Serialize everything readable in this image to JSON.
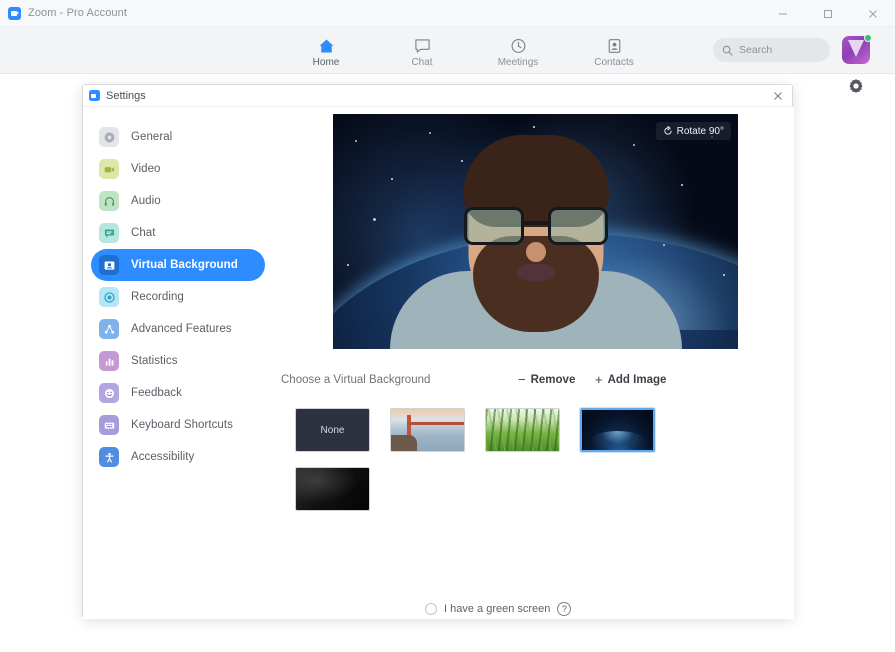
{
  "window": {
    "title": "Zoom - Pro Account",
    "app_icon": "zoom-camera-icon",
    "minimize_label": "–",
    "maximize_label": "□",
    "close_label": "✕"
  },
  "navbar": {
    "tabs": [
      {
        "label": "Home",
        "icon": "home-icon",
        "active": true
      },
      {
        "label": "Chat",
        "icon": "chat-bubble-icon",
        "active": false
      },
      {
        "label": "Meetings",
        "icon": "clock-icon",
        "active": false
      },
      {
        "label": "Contacts",
        "icon": "contacts-icon",
        "active": false
      }
    ],
    "search": {
      "placeholder": "Search",
      "icon": "search-icon"
    },
    "avatar": {
      "name": "user-avatar",
      "status": "available",
      "status_color": "#32c36c"
    },
    "gear": {
      "icon": "gear-icon"
    }
  },
  "dialog": {
    "title": "Settings",
    "icon": "zoom-camera-icon",
    "close_label": "✕"
  },
  "sidebar": {
    "items": [
      {
        "label": "General",
        "icon": "gear-icon",
        "color": "#c8cbd0",
        "active": false
      },
      {
        "label": "Video",
        "icon": "video-camera-icon",
        "color": "#c3d35e",
        "active": false
      },
      {
        "label": "Audio",
        "icon": "headphones-icon",
        "color": "#6dc07a",
        "active": false
      },
      {
        "label": "Chat",
        "icon": "chat-bubble-icon",
        "color": "#57c8bc",
        "active": false
      },
      {
        "label": "Virtual Background",
        "icon": "person-card-icon",
        "color": "#2d8cff",
        "active": true
      },
      {
        "label": "Recording",
        "icon": "record-dot-icon",
        "color": "#4fc3e8",
        "active": false
      },
      {
        "label": "Advanced Features",
        "icon": "network-nodes-icon",
        "color": "#6aa6e8",
        "active": false
      },
      {
        "label": "Statistics",
        "icon": "bar-chart-icon",
        "color": "#b57ac8",
        "active": false
      },
      {
        "label": "Feedback",
        "icon": "smiley-icon",
        "color": "#9b86d8",
        "active": false
      },
      {
        "label": "Keyboard Shortcuts",
        "icon": "keyboard-icon",
        "color": "#8a7fd0",
        "active": false
      },
      {
        "label": "Accessibility",
        "icon": "accessibility-person-icon",
        "color": "#4f8ee0",
        "active": false
      }
    ]
  },
  "content": {
    "video_preview": {
      "rotate_button": {
        "label": "Rotate 90°",
        "icon": "rotate-icon"
      },
      "scene_description": "Bearded man with glasses in front of Earth-from-space virtual background"
    },
    "choose_label": "Choose a Virtual Background",
    "remove_button": {
      "sign": "−",
      "label": "Remove"
    },
    "add_image_button": {
      "sign": "+",
      "label": "Add Image"
    },
    "backgrounds": [
      {
        "name": "None",
        "label": "None",
        "style": "none",
        "selected": false
      },
      {
        "name": "Golden Gate Bridge",
        "label": "",
        "style": "bridge",
        "selected": false
      },
      {
        "name": "Grass",
        "label": "",
        "style": "grass",
        "selected": false
      },
      {
        "name": "Earth from Space",
        "label": "",
        "style": "earth",
        "selected": true
      },
      {
        "name": "Dark Image",
        "label": "",
        "style": "dark",
        "selected": false
      }
    ],
    "green_screen": {
      "label": "I have a green screen",
      "checked": false,
      "help_icon": "question-mark-icon",
      "help_label": "?"
    }
  },
  "colors": {
    "accent": "#2d8cff",
    "titlebar_bg": "#f7f8fa",
    "navbar_bg": "#f3f4f6",
    "dialog_bg": "#ffffff",
    "selected_thumb_border": "#5ea9f0"
  }
}
